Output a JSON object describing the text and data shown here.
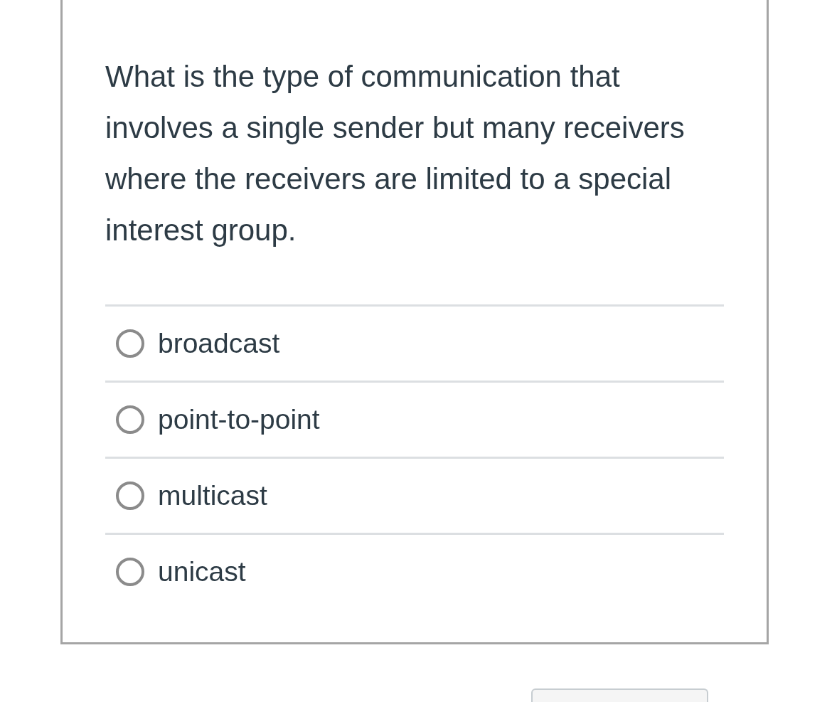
{
  "question": {
    "text": "What is the type of communication that involves a single sender but many receivers where the receivers are limited to a special interest group."
  },
  "options": [
    {
      "label": "broadcast",
      "selected": false
    },
    {
      "label": "point-to-point",
      "selected": false
    },
    {
      "label": "multicast",
      "selected": false
    },
    {
      "label": "unicast",
      "selected": false
    }
  ]
}
